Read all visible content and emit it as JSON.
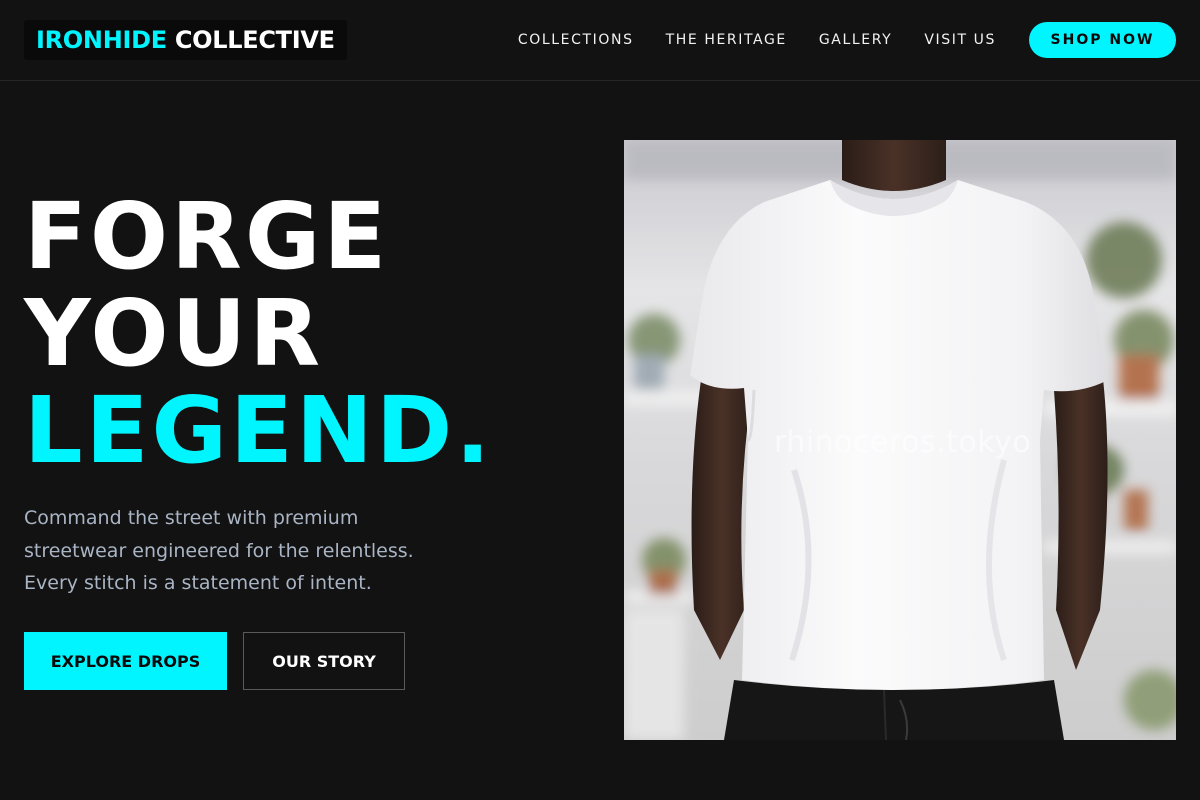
{
  "header": {
    "brand_accent": "IRONHIDE",
    "brand_rest": "COLLECTIVE",
    "nav": [
      {
        "label": "COLLECTIONS"
      },
      {
        "label": "THE HERITAGE"
      },
      {
        "label": "GALLERY"
      },
      {
        "label": "VISIT US"
      }
    ],
    "cta_label": "SHOP NOW"
  },
  "hero": {
    "headline_line1": "FORGE",
    "headline_line2": "YOUR",
    "headline_line3": "LEGEND.",
    "subtitle": "Command the street with premium streetwear engineered for the relentless. Every stitch is a statement of intent.",
    "primary_button": "EXPLORE DROPS",
    "secondary_button": "OUR STORY",
    "image_watermark": "rhinoceros.tokyo"
  },
  "colors": {
    "background": "#121212",
    "accent": "#00f5ff",
    "text": "#ffffff",
    "muted_text": "#a9b4c4"
  }
}
